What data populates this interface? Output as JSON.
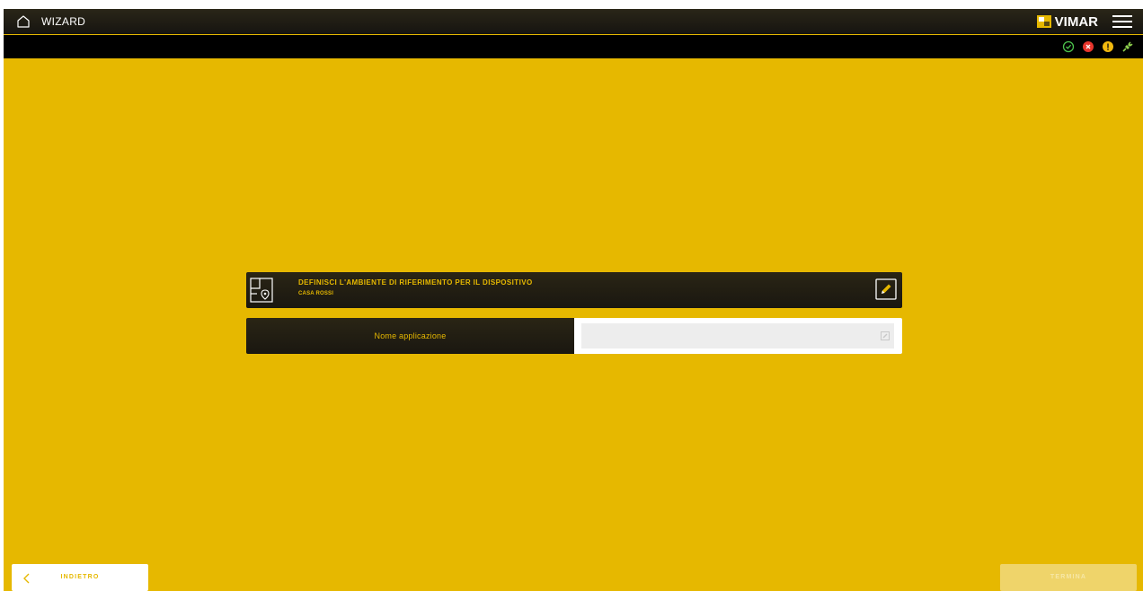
{
  "header": {
    "title": "WIZARD",
    "brand": "VIMAR"
  },
  "status_icons": [
    "check-circle-icon",
    "error-circle-icon",
    "warning-circle-icon",
    "plug-connected-icon"
  ],
  "colors": {
    "accent": "#e6b800",
    "bar_dark": "#1a1710",
    "ok": "#4cc24c",
    "error": "#e8352c",
    "warning": "#f2b90f"
  },
  "environment": {
    "title": "DEFINISCI L'AMBIENTE DI RIFERIMENTO PER IL DISPOSITIVO",
    "subtitle": "CASA ROSSI"
  },
  "app_name": {
    "label": "Nome applicazione",
    "value": "",
    "placeholder": ""
  },
  "footer": {
    "back_label": "INDIETRO",
    "finish_label": "TERMINA"
  }
}
